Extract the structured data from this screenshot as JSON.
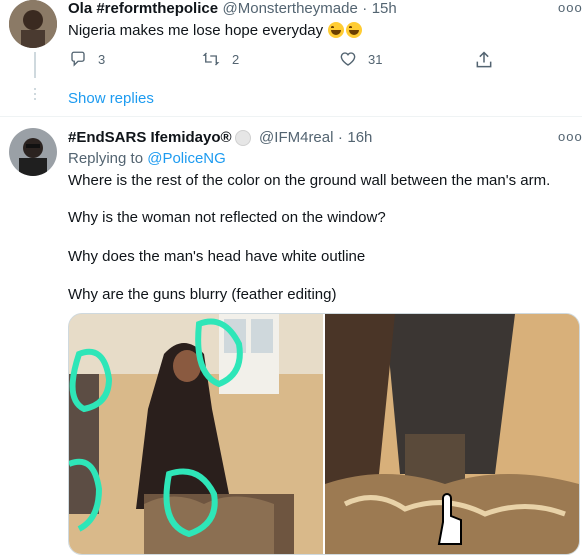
{
  "tweet1": {
    "display_name": "Ola #reformthepolice",
    "handle": "@Monstertheymade",
    "separator": "·",
    "time": "15h",
    "text": "Nigeria makes me lose hope everyday",
    "emoji": "😂😂",
    "replies": "3",
    "retweets": "2",
    "likes": "31",
    "more": "ooo"
  },
  "show_replies": "Show replies",
  "tweet2": {
    "display_name": "#EndSARS Ifemidayo®",
    "handle": "@IFM4real",
    "separator": "·",
    "time": "16h",
    "replying_label": "Replying to",
    "replying_to": "@PoliceNG",
    "lines": [
      "Where is the rest of the color on the ground wall between the man's arm.",
      "Why is the woman not reflected on the window?",
      "Why does the man's head have white outline",
      "Why are the guns blurry (feather editing)"
    ],
    "more": "ooo"
  },
  "colors": {
    "accent": "#1d9bf0",
    "text": "#0f1419",
    "muted": "#536471",
    "annotation": "#2ee6b8"
  },
  "icons": [
    "reply-icon",
    "retweet-icon",
    "like-icon",
    "share-icon",
    "more-icon"
  ]
}
